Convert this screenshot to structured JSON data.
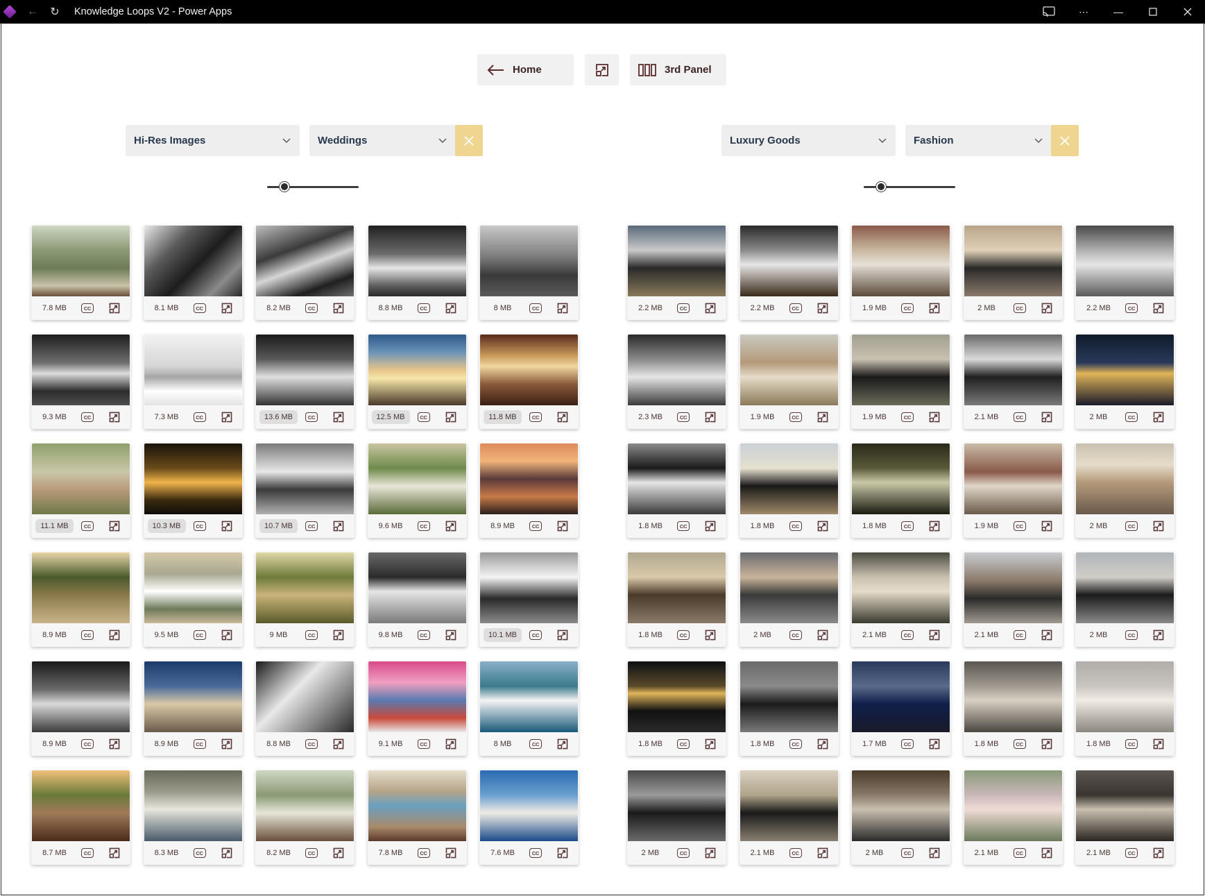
{
  "window": {
    "title": "Knowledge Loops V2 - Power Apps"
  },
  "toolbar": {
    "home_label": "Home",
    "third_panel_label": "3rd Panel"
  },
  "left_panel": {
    "category": "Hi-Res Images",
    "subcategory": "Weddings",
    "zoom_level": 0.15,
    "cards": [
      {
        "size": "7.8 MB",
        "img": "linear-gradient(180deg,#cfd6c2 0%,#8a9a74 35%,#6d7b58 60%,#c9c1a8 85%,#6a4f3a 100%)"
      },
      {
        "size": "8.1 MB",
        "img": "linear-gradient(135deg,#e9e9e9 0%,#5a5a5a 30%,#1c1c1c 55%,#8a8a8a 80%,#2a2a2a 100%)"
      },
      {
        "size": "8.2 MB",
        "img": "linear-gradient(160deg,#bdbdbd 0%,#3b3b3b 35%,#d6d6d6 55%,#1f1f1f 80%,#6e6e6e 100%)"
      },
      {
        "size": "8.8 MB",
        "img": "linear-gradient(180deg,#202020 0%,#6b6b6b 40%,#e6e6e6 60%,#5e5e5e 85%,#2a2a2a 100%)"
      },
      {
        "size": "8 MB",
        "img": "linear-gradient(180deg,#c8c8c8 0%,#7a7a7a 45%,#3a3a3a 70%,#5a5a5a 100%)"
      },
      {
        "size": "9.3 MB",
        "img": "linear-gradient(180deg,#1d1d1d 0%,#6e6e6e 40%,#dcdcdc 55%,#2c2c2c 80%,#4e4e4e 100%)"
      },
      {
        "size": "7.3 MB",
        "img": "linear-gradient(180deg,#f2f2f2 0%,#d5d5d5 45%,#a6a6a6 60%,#ffffff 80%,#e3e3e3 100%)"
      },
      {
        "size": "13.6 MB",
        "img": "linear-gradient(180deg,#1a1a1a 0%,#5a5a5a 35%,#e0e0e0 60%,#333333 100%)",
        "hl": true
      },
      {
        "size": "12.5 MB",
        "img": "linear-gradient(180deg,#2e5a8a 0%,#6b93b8 25%,#e6c48a 50%,#f6e6a8 62%,#4a3a2a 100%)",
        "hl": true
      },
      {
        "size": "11.8 MB",
        "img": "linear-gradient(180deg,#5a2a1a 0%,#c99a5a 30%,#f0d8a0 45%,#8a5a3a 70%,#3a1f15 100%)",
        "hl": true
      },
      {
        "size": "11.1 MB",
        "img": "linear-gradient(180deg,#8fa06a 0%,#c9c7a8 40%,#b99a7a 65%,#6e7a4a 100%)",
        "hl": true
      },
      {
        "size": "10.3 MB",
        "img": "linear-gradient(180deg,#1a140c 0%,#6a4a1a 35%,#f0b44a 55%,#3a2a10 80%,#0f0c08 100%)",
        "hl": true
      },
      {
        "size": "10.7 MB",
        "img": "linear-gradient(180deg,#7a7a7a 0%,#e8e8e8 40%,#3a3a3a 65%,#b0b0b0 100%)",
        "hl": true
      },
      {
        "size": "9.6 MB",
        "img": "linear-gradient(180deg,#c9c5a0 0%,#6e8a4a 35%,#e9e6d8 60%,#5a6a3a 100%)"
      },
      {
        "size": "8.9 MB",
        "img": "linear-gradient(180deg,#e08a5a 0%,#f0b47a 25%,#5a3a3a 50%,#c97a4a 75%,#2a1f1a 100%)"
      },
      {
        "size": "8.9 MB",
        "img": "linear-gradient(180deg,#e8d6a8 0%,#4a5a2a 35%,#8a7a4a 60%,#c9b48a 100%)"
      },
      {
        "size": "9.5 MB",
        "img": "linear-gradient(180deg,#d6c9a8 0%,#a8a890 30%,#ffffff 55%,#6e7a5a 80%,#c9b89a 100%)"
      },
      {
        "size": "9 MB",
        "img": "linear-gradient(180deg,#e0d8a8 0%,#6e7a3a 35%,#c9b47a 60%,#5a5a2a 100%)"
      },
      {
        "size": "9.8 MB",
        "img": "linear-gradient(180deg,#6a6a6a 0%,#2a2a2a 35%,#e6e6e6 55%,#7a7a7a 100%)"
      },
      {
        "size": "10.1 MB",
        "img": "linear-gradient(180deg,#9a9a9a 0%,#f4f4f4 35%,#2a2a2a 65%,#8a8a8a 100%)",
        "hl": true
      },
      {
        "size": "8.9 MB",
        "img": "linear-gradient(180deg,#1a1a1a 0%,#6a6a6a 40%,#d9d9d9 60%,#3a3a3a 100%)"
      },
      {
        "size": "8.9 MB",
        "img": "linear-gradient(180deg,#1a3a6a 0%,#4a6a9a 35%,#d9c9a8 60%,#6a5a4a 100%)"
      },
      {
        "size": "8.8 MB",
        "img": "linear-gradient(135deg,#1a1a1a 0%,#e8e8e8 40%,#8a8a8a 70%,#2a2a2a 100%)"
      },
      {
        "size": "9.1 MB",
        "img": "linear-gradient(180deg,#d94a8a 0%,#f0a0c0 30%,#5a7ab0 55%,#c94a3a 80%,#e8e8e8 100%)"
      },
      {
        "size": "8 MB",
        "img": "linear-gradient(180deg,#8ab0c9 0%,#3a7a8a 35%,#f4f4f4 55%,#1a5a7a 100%)"
      },
      {
        "size": "8.7 MB",
        "img": "linear-gradient(180deg,#f0c07a 0%,#6a7a3a 35%,#a07a5a 60%,#4a2a1a 100%)"
      },
      {
        "size": "8.3 MB",
        "img": "linear-gradient(180deg,#6a6a5a 0%,#9a9a8a 30%,#e6e6dc 55%,#4a5a6a 100%)"
      },
      {
        "size": "8.2 MB",
        "img": "linear-gradient(180deg,#cfd6c2 0%,#8a9a74 35%,#e6e6d8 60%,#6a4f3a 100%)"
      },
      {
        "size": "7.8 MB",
        "img": "linear-gradient(180deg,#e6dcc9 0%,#b4a48a 30%,#6aa0c0 50%,#a88a6a 80%,#5a3a2a 100%)"
      },
      {
        "size": "7.6 MB",
        "img": "linear-gradient(180deg,#2a6ab0 0%,#6aa0d0 35%,#f0ece4 60%,#1a4a8a 100%)"
      }
    ]
  },
  "right_panel": {
    "category": "Luxury Goods",
    "subcategory": "Fashion",
    "zoom_level": 0.15,
    "cards": [
      {
        "size": "2.2 MB",
        "img": "linear-gradient(180deg,#5a6a7a 0%,#c9c9c9 35%,#2a2a2a 60%,#8a7a5a 100%)"
      },
      {
        "size": "2.2 MB",
        "img": "linear-gradient(180deg,#2a2a2a 0%,#8a8a8a 35%,#e6e6e6 55%,#3a2a1a 100%)"
      },
      {
        "size": "1.9 MB",
        "img": "linear-gradient(180deg,#8a5a4a 0%,#c9b8a0 35%,#e6e0d8 55%,#5a4a3a 100%)"
      },
      {
        "size": "2 MB",
        "img": "linear-gradient(180deg,#b9a48a 0%,#e0d0b8 35%,#2a2a2a 60%,#8a7a6a 100%)"
      },
      {
        "size": "2.2 MB",
        "img": "linear-gradient(180deg,#4a4a4a 0%,#b0b0b0 35%,#e6e6e6 55%,#5a5a5a 100%)"
      },
      {
        "size": "2.3 MB",
        "img": "linear-gradient(180deg,#2a2a2a 0%,#8a8a8a 35%,#e6e6e6 60%,#3a3a3a 100%)"
      },
      {
        "size": "1.9 MB",
        "img": "linear-gradient(180deg,#c9c9c0 0%,#b49a7a 40%,#e6dcc9 60%,#8a7a5a 100%)"
      },
      {
        "size": "1.9 MB",
        "img": "linear-gradient(180deg,#a0a090 0%,#c9c0b0 35%,#1a1a1a 60%,#6a6a5a 100%)"
      },
      {
        "size": "2.1 MB",
        "img": "linear-gradient(180deg,#6a6a6a 0%,#d9d9d9 35%,#1f1f1f 60%,#7a7a7a 100%)"
      },
      {
        "size": "2 MB",
        "img": "linear-gradient(180deg,#0f1a2a 0%,#2a3a5a 40%,#e0b45a 55%,#1a1a2a 100%)"
      },
      {
        "size": "1.8 MB",
        "img": "linear-gradient(180deg,#8a8a8a 0%,#1a1a1a 35%,#e6e6e6 55%,#3a3a3a 100%)"
      },
      {
        "size": "1.8 MB",
        "img": "linear-gradient(180deg,#c9d0d6 0%,#e6e0d0 35%,#1a1a1a 60%,#a08a6a 100%)"
      },
      {
        "size": "1.8 MB",
        "img": "linear-gradient(180deg,#2a2a1a 0%,#5a5a3a 35%,#c9c9a8 55%,#1a1a10 100%)"
      },
      {
        "size": "1.9 MB",
        "img": "linear-gradient(180deg,#c9bca8 0%,#8a5a4a 40%,#e0d6c9 60%,#6a5a4a 100%)"
      },
      {
        "size": "2 MB",
        "img": "linear-gradient(180deg,#c9c0b0 0%,#e6dcc9 30%,#b49a7a 55%,#6a5a4a 100%)"
      },
      {
        "size": "1.8 MB",
        "img": "linear-gradient(180deg,#b0a890 0%,#d9c9a8 35%,#4a3a2a 60%,#8a7a6a 100%)"
      },
      {
        "size": "2 MB",
        "img": "linear-gradient(180deg,#6a6a70 0%,#c9b49a 35%,#3a3a3a 60%,#8a8a8a 100%)"
      },
      {
        "size": "2.1 MB",
        "img": "linear-gradient(180deg,#4a4a40 0%,#c9c0b0 35%,#e6dcc9 55%,#3a3a30 100%)"
      },
      {
        "size": "2.1 MB",
        "img": "linear-gradient(180deg,#c9cbd0 0%,#8a7a6a 40%,#2a2a2a 65%,#a09a90 100%)"
      },
      {
        "size": "2 MB",
        "img": "linear-gradient(180deg,#b0b4b8 0%,#d0cdc8 35%,#1a1a1a 60%,#8a8a8a 100%)"
      },
      {
        "size": "1.8 MB",
        "img": "linear-gradient(180deg,#0f0f14 0%,#5a4a2a 35%,#e0b45a 45%,#111111 70%,#2a2a2a 100%)"
      },
      {
        "size": "1.8 MB",
        "img": "linear-gradient(180deg,#6a6a6a 0%,#8a8a8a 35%,#1a1a1a 60%,#7a7a7a 100%)"
      },
      {
        "size": "1.7 MB",
        "img": "linear-gradient(180deg,#2a3a5a 0%,#5a6a8a 35%,#0f1f4a 60%,#1a1a2a 100%)"
      },
      {
        "size": "1.8 MB",
        "img": "linear-gradient(180deg,#5a5650 0%,#a09a90 35%,#d9d0c4 55%,#4a4640 100%)"
      },
      {
        "size": "1.8 MB",
        "img": "linear-gradient(180deg,#b0ada8 0%,#c9c6c0 35%,#f0ece4 55%,#8a8680 100%)"
      },
      {
        "size": "2 MB",
        "img": "linear-gradient(180deg,#4a4a4a 0%,#9a9a9a 35%,#1a1a1a 60%,#6a6a6a 100%)"
      },
      {
        "size": "2.1 MB",
        "img": "linear-gradient(180deg,#d9d0c0 0%,#b0a48a 35%,#1a1a1a 60%,#8a8070 100%)"
      },
      {
        "size": "2 MB",
        "img": "linear-gradient(180deg,#4a3a2a 0%,#8a7a6a 35%,#c9c0b0 55%,#2a2a2a 100%)"
      },
      {
        "size": "2.1 MB",
        "img": "linear-gradient(180deg,#8a9a7a 0%,#c9b8b8 35%,#f0dcd6 55%,#6a7a5a 100%)"
      },
      {
        "size": "2.1 MB",
        "img": "linear-gradient(180deg,#5a5550 0%,#3a3530 35%,#c9c0b0 55%,#2a2520 100%)"
      }
    ]
  },
  "icons": {
    "back": "arrow-left-icon",
    "expand": "expand-window-icon",
    "panel": "three-panel-icon",
    "caption": "closed-caption-icon",
    "clear": "close-icon",
    "chevron": "chevron-down-icon"
  },
  "colors": {
    "clear_button": "#f0d591",
    "dropdown_bg": "#eeeeee",
    "dropdown_text": "#27374d",
    "icon_brown": "#5a3a3a"
  }
}
